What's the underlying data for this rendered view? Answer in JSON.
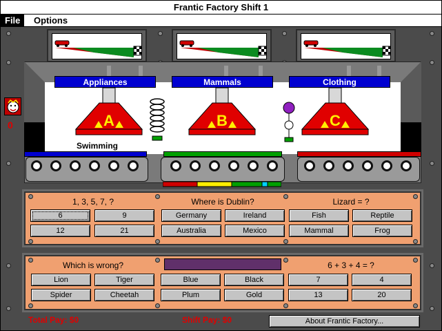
{
  "window": {
    "title": "Frantic Factory Shift 1"
  },
  "menu": {
    "file": "File",
    "options": "Options"
  },
  "machine": {
    "categories": [
      "Appliances",
      "Mammals",
      "Clothing"
    ],
    "funnels": [
      "A",
      "B",
      "C"
    ],
    "current_word": "Swimming"
  },
  "score": "0",
  "colors": {
    "belt_a": "#0000d0",
    "belt_b": "#00a000",
    "belt_c": "#d00000",
    "panel": "#f0a070",
    "pay_text": "#e00000"
  },
  "panel1": {
    "q1": {
      "prompt": "1, 3, 5, 7, ?",
      "answers": [
        "6",
        "9",
        "12",
        "21"
      ]
    },
    "q2": {
      "prompt": "Where is Dublin?",
      "answers": [
        "Germany",
        "Ireland",
        "Australia",
        "Mexico"
      ]
    },
    "q3": {
      "prompt": "Lizard = ?",
      "answers": [
        "Fish",
        "Reptile",
        "Mammal",
        "Frog"
      ]
    }
  },
  "panel2": {
    "q1": {
      "prompt": "Which is wrong?",
      "answers": [
        "Lion",
        "Tiger",
        "Spider",
        "Cheetah"
      ]
    },
    "q2": {
      "prompt": "",
      "answers": [
        "Blue",
        "Black",
        "Plum",
        "Gold"
      ]
    },
    "q3": {
      "prompt": "6 + 3 + 4 = ?",
      "answers": [
        "7",
        "4",
        "13",
        "20"
      ]
    }
  },
  "footer": {
    "total_pay": "Total Pay: $0",
    "shift_pay": "Shift Pay: $0",
    "about": "About Frantic Factory..."
  }
}
